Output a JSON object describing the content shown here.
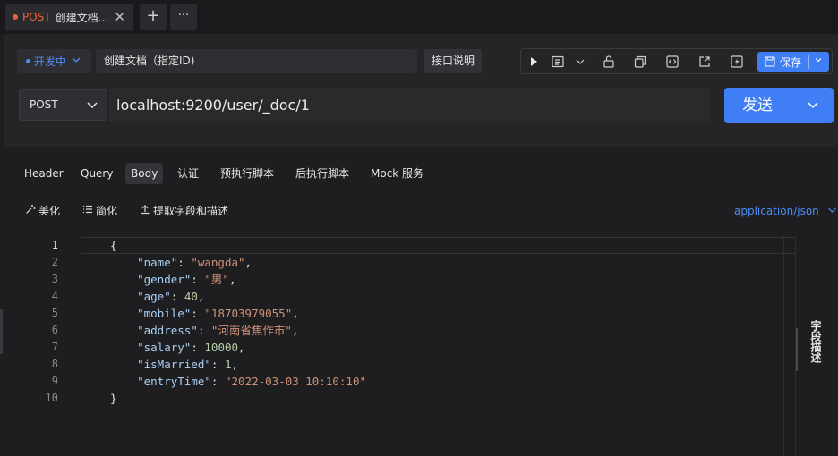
{
  "tab": {
    "method": "POST",
    "title": "创建文档...",
    "close_glyph": "✕",
    "add_glyph": "+",
    "more_glyph": "···"
  },
  "request": {
    "status": "开发中",
    "name": "创建文档（指定ID)",
    "doc_label": "接口说明",
    "save_label": "保存",
    "method": "POST",
    "url": "localhost:9200/user/_doc/1",
    "send_label": "发送"
  },
  "subtabs": [
    "Header",
    "Query",
    "Body",
    "认证",
    "预执行脚本",
    "后执行脚本",
    "Mock 服务"
  ],
  "body_tools": {
    "beautify": "美化",
    "simplify": "简化",
    "extract": "提取字段和描述",
    "content_type": "application/json"
  },
  "editor": {
    "line_numbers": [
      "1",
      "2",
      "3",
      "4",
      "5",
      "6",
      "7",
      "8",
      "9",
      "10"
    ],
    "lines": [
      {
        "indent": "",
        "parts": [
          {
            "t": "p",
            "v": "{"
          }
        ]
      },
      {
        "indent": "    ",
        "parts": [
          {
            "t": "k",
            "v": "\"name\""
          },
          {
            "t": "p",
            "v": ": "
          },
          {
            "t": "s",
            "v": "\"wangda\""
          },
          {
            "t": "p",
            "v": ","
          }
        ]
      },
      {
        "indent": "    ",
        "parts": [
          {
            "t": "k",
            "v": "\"gender\""
          },
          {
            "t": "p",
            "v": ": "
          },
          {
            "t": "s",
            "v": "\"男\""
          },
          {
            "t": "p",
            "v": ","
          }
        ]
      },
      {
        "indent": "    ",
        "parts": [
          {
            "t": "k",
            "v": "\"age\""
          },
          {
            "t": "p",
            "v": ": "
          },
          {
            "t": "n",
            "v": "40"
          },
          {
            "t": "p",
            "v": ","
          }
        ]
      },
      {
        "indent": "    ",
        "parts": [
          {
            "t": "k",
            "v": "\"mobile\""
          },
          {
            "t": "p",
            "v": ": "
          },
          {
            "t": "s",
            "v": "\"18703979055\""
          },
          {
            "t": "p",
            "v": ","
          }
        ]
      },
      {
        "indent": "    ",
        "parts": [
          {
            "t": "k",
            "v": "\"address\""
          },
          {
            "t": "p",
            "v": ": "
          },
          {
            "t": "s",
            "v": "\"河南省焦作市\""
          },
          {
            "t": "p",
            "v": ","
          }
        ]
      },
      {
        "indent": "    ",
        "parts": [
          {
            "t": "k",
            "v": "\"salary\""
          },
          {
            "t": "p",
            "v": ": "
          },
          {
            "t": "n",
            "v": "10000"
          },
          {
            "t": "p",
            "v": ","
          }
        ]
      },
      {
        "indent": "    ",
        "parts": [
          {
            "t": "k",
            "v": "\"isMarried\""
          },
          {
            "t": "p",
            "v": ": "
          },
          {
            "t": "n",
            "v": "1"
          },
          {
            "t": "p",
            "v": ","
          }
        ]
      },
      {
        "indent": "    ",
        "parts": [
          {
            "t": "k",
            "v": "\"entryTime\""
          },
          {
            "t": "p",
            "v": ": "
          },
          {
            "t": "s",
            "v": "\"2022-03-03 10:10:10\""
          }
        ]
      },
      {
        "indent": "",
        "parts": [
          {
            "t": "p",
            "v": "}"
          }
        ]
      }
    ]
  },
  "side_panel": {
    "label": "字段描述"
  },
  "colors": {
    "accent": "#3f7ef5",
    "method_post": "#e8623b",
    "json_key": "#a9d1f7",
    "json_string": "#ce9178",
    "json_number": "#b5cea8"
  }
}
